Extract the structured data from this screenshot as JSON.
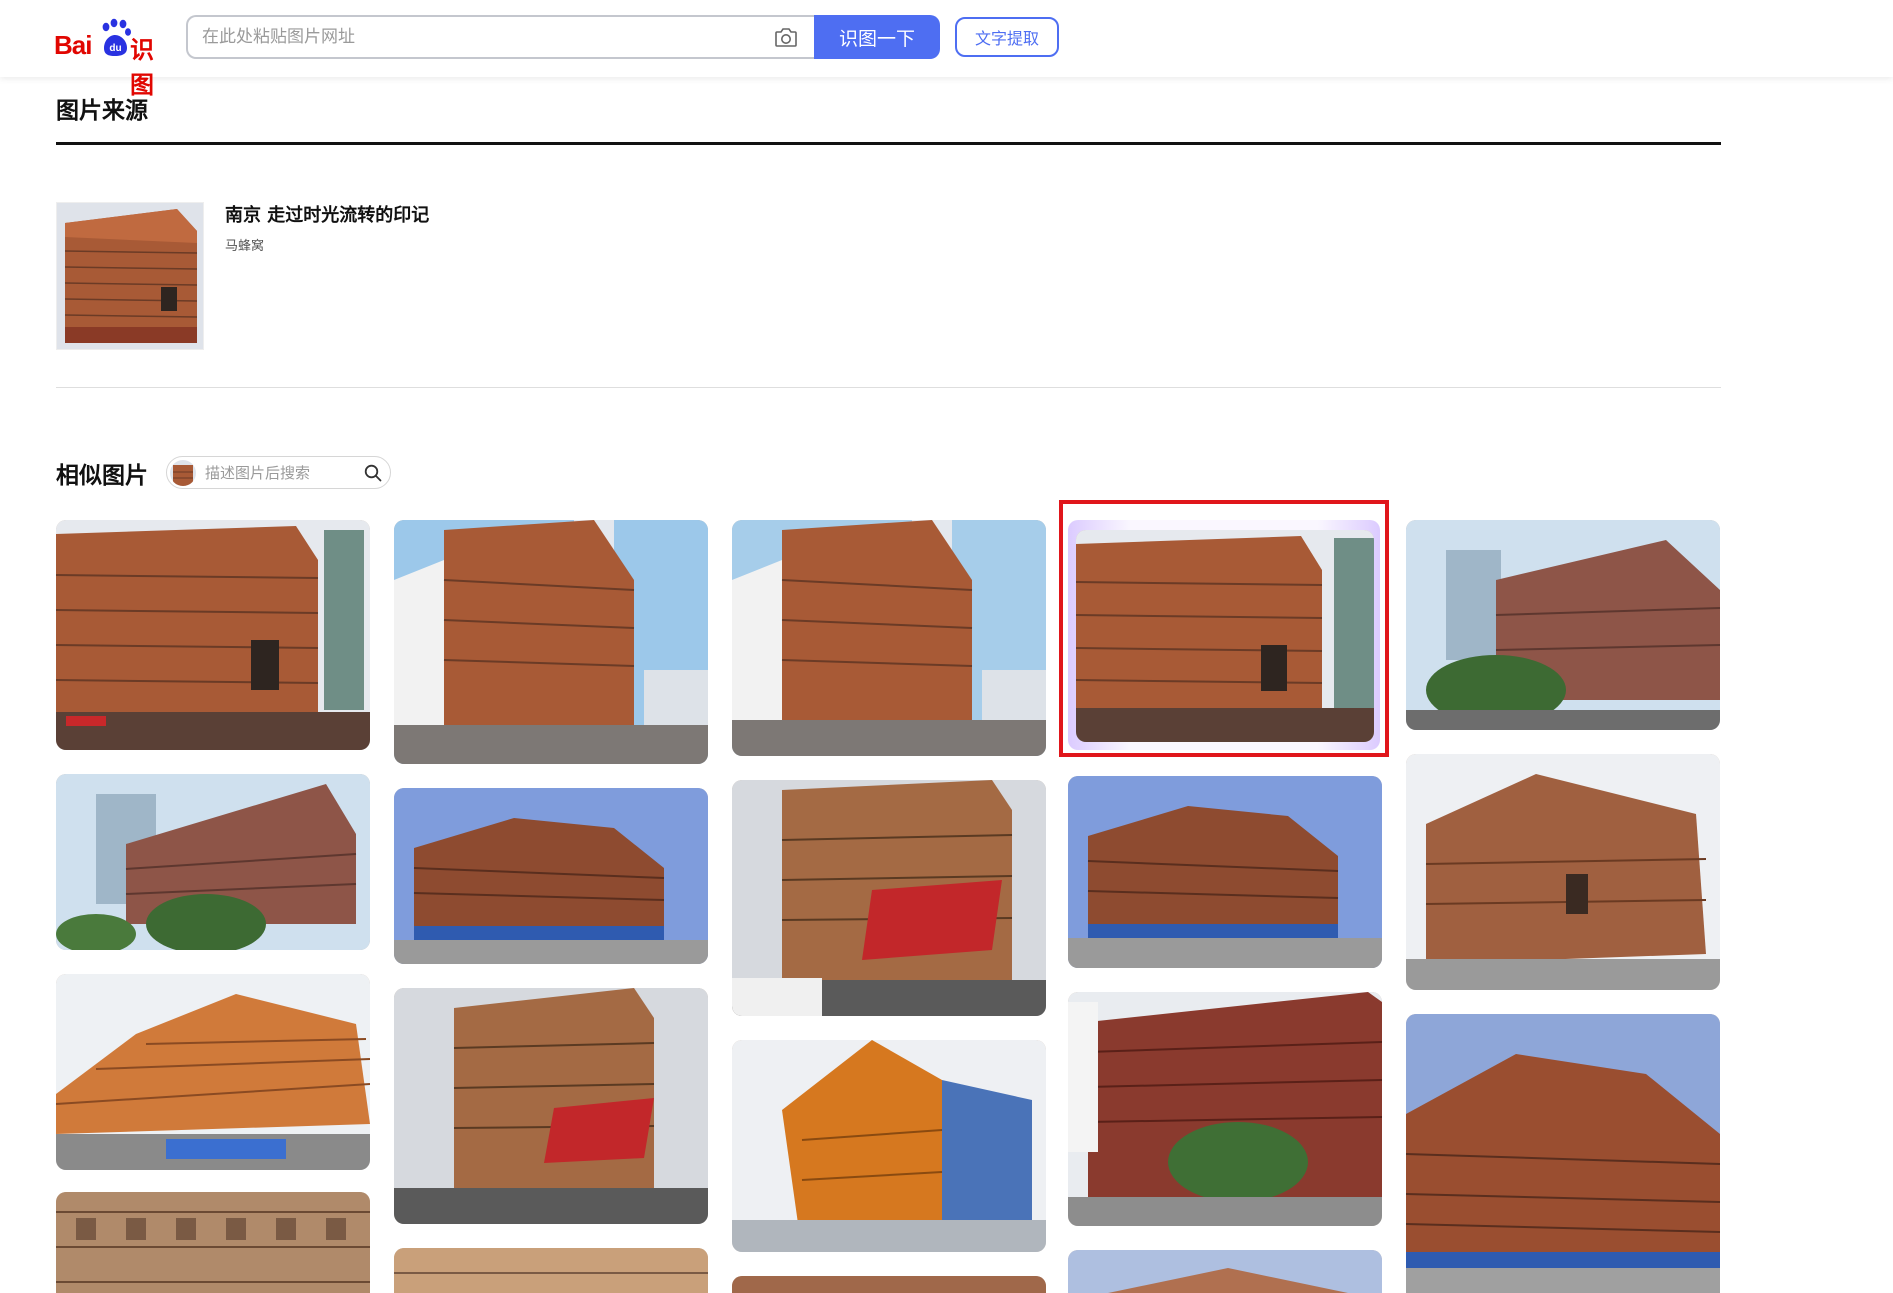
{
  "header": {
    "logo_text_latin": "Bai",
    "logo_text_du": "du",
    "logo_text_cn": "识图",
    "search_placeholder": "在此处粘贴图片网址",
    "search_button": "识图一下",
    "ocr_button": "文字提取"
  },
  "source_section": {
    "title": "图片来源",
    "items": [
      {
        "title": "南京 走过时光流转的印记",
        "site": "马蜂窝"
      }
    ]
  },
  "similar_section": {
    "title": "相似图片",
    "desc_search_placeholder": "描述图片后搜索"
  },
  "colors": {
    "brand_red": "#e10601",
    "accent_blue": "#4e6ef2",
    "highlight_red": "#e0161b"
  },
  "icons": [
    "baidu-paw-icon",
    "camera-icon",
    "search-icon"
  ]
}
